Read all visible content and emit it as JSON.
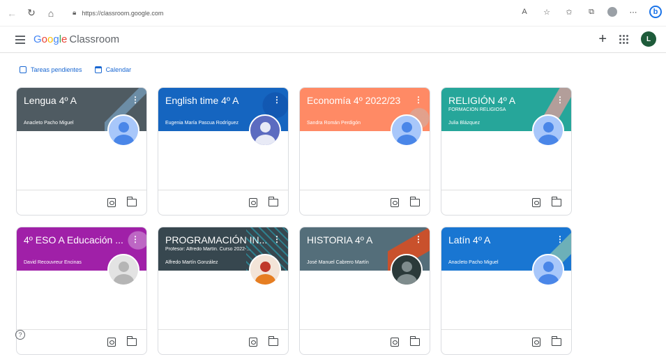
{
  "browser": {
    "url": "https://classroom.google.com",
    "back_icon": "arrow-left-icon",
    "reload_icon": "reload-icon",
    "home_icon": "home-icon"
  },
  "header": {
    "logo_g": "G",
    "logo_o1": "o",
    "logo_o2": "o",
    "logo_g2": "g",
    "logo_l": "l",
    "logo_e": "e",
    "product": "Classroom",
    "account_initial": "L"
  },
  "links": {
    "pending": "Tareas pendientes",
    "calendar": "Calendar"
  },
  "colors": {
    "lengua": "#4f5b62",
    "english": "#1565c0",
    "economia": "#ff8a65",
    "religion": "#26a69a",
    "eso": "#a020a8",
    "programacion": "#37474f",
    "historia": "#546e7a",
    "latin": "#1976d2"
  },
  "courses": [
    {
      "title": "Lengua 4º A",
      "subtitle": "",
      "teacher": "Anacleto Pacho Miguel"
    },
    {
      "title": "English time 4º A",
      "subtitle": "",
      "teacher": "Eugenia María Pascua Rodríguez"
    },
    {
      "title": "Economía 4º 2022/23",
      "subtitle": "",
      "teacher": "Sandra Román Perdigón"
    },
    {
      "title": "RELIGIÓN 4º A",
      "subtitle": "FORMACIÓN RELIGIOSA",
      "teacher": "Julia Blázquez"
    },
    {
      "title": "4º ESO A Educación ...",
      "subtitle": "",
      "teacher": "David Recouvreur Encinas"
    },
    {
      "title": "PROGRAMACIÓN IN...",
      "subtitle": "Profesor: Alfredo Martín. Curso 2022-...",
      "teacher": "Alfredo Martín González"
    },
    {
      "title": "HISTORIA 4º A",
      "subtitle": "",
      "teacher": "José Manuel Cabrero Martín"
    },
    {
      "title": "Latín 4º A",
      "subtitle": "",
      "teacher": "Anacleto Pacho Miguel"
    }
  ],
  "help": "?"
}
